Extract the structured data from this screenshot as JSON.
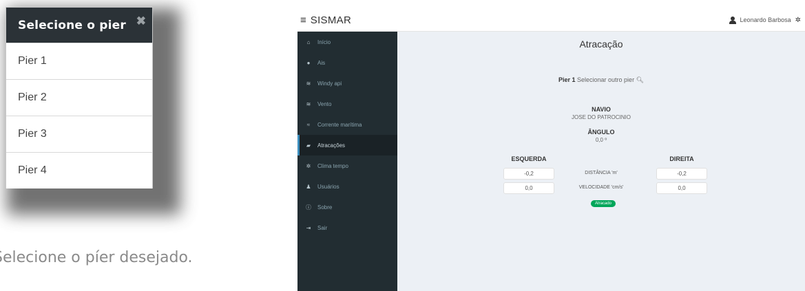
{
  "modal": {
    "title": "Selecione o pier",
    "close": "✖",
    "piers": [
      "Pier 1",
      "Pier 2",
      "Pier 3",
      "Pier 4"
    ]
  },
  "caption": "Selecione o píer desejado.",
  "app": {
    "title": "SISMAR",
    "user": "Leonardo Barbosa",
    "nav": [
      {
        "label": "Início",
        "icon": "home-icon",
        "glyph": "⌂"
      },
      {
        "label": "Ais",
        "icon": "map-marker-icon",
        "glyph": "●"
      },
      {
        "label": "Windy api",
        "icon": "wind-icon",
        "glyph": "≋"
      },
      {
        "label": "Vento",
        "icon": "wind-icon",
        "glyph": "≋"
      },
      {
        "label": "Corrente marítima",
        "icon": "wave-icon",
        "glyph": "≈"
      },
      {
        "label": "Atracações",
        "icon": "ship-icon",
        "glyph": "▰",
        "active": true
      },
      {
        "label": "Clima tempo",
        "icon": "sun-icon",
        "glyph": "✲"
      },
      {
        "label": "Usuários",
        "icon": "users-icon",
        "glyph": "♟"
      },
      {
        "label": "Sobre",
        "icon": "info-icon",
        "glyph": "ⓘ"
      },
      {
        "label": "Sair",
        "icon": "sign-out-icon",
        "glyph": "⇥"
      }
    ],
    "page_title": "Atracação",
    "pier_current": "Pier 1",
    "pier_select": "Selecionar outro pier",
    "navio_label": "NAVIO",
    "navio_value": "JOSE DO PATROCINIO",
    "angulo_label": "ÂNGULO",
    "angulo_value": "0,0 º",
    "esquerda": "ESQUERDA",
    "direita": "DIREITA",
    "distancia_label": "DISTÂNCIA 'm'",
    "velocidade_label": "VELOCIDADE 'cm/s'",
    "esq_distancia": "-0,2",
    "esq_velocidade": "0,0",
    "dir_distancia": "-0,2",
    "dir_velocidade": "0,0",
    "status": "Atracado",
    "accent": "#3c8dbc",
    "status_color": "#00a65a"
  }
}
